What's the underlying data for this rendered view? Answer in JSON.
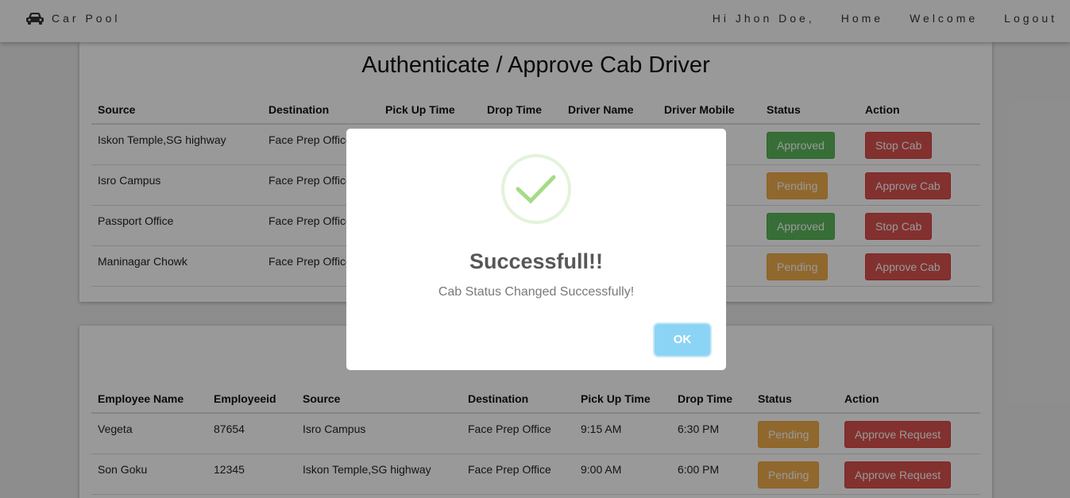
{
  "navbar": {
    "brand": "Car Pool",
    "greeting": "Hi Jhon Doe,",
    "links": [
      "Home",
      "Welcome",
      "Logout"
    ]
  },
  "cab_section": {
    "title": "Authenticate / Approve Cab Driver",
    "headers": [
      "Source",
      "Destination",
      "Pick Up Time",
      "Drop Time",
      "Driver Name",
      "Driver Mobile",
      "Status",
      "Action"
    ],
    "rows": [
      {
        "source": "Iskon Temple,SG highway",
        "destination": "Face Prep Office",
        "status": "Approved",
        "action": "Stop Cab"
      },
      {
        "source": "Isro Campus",
        "destination": "Face Prep Office",
        "status": "Pending",
        "action": "Approve Cab"
      },
      {
        "source": "Passport Office",
        "destination": "Face Prep Office",
        "status": "Approved",
        "action": "Stop Cab"
      },
      {
        "source": "Maninagar Chowk",
        "destination": "Face Prep Office",
        "status": "Pending",
        "action": "Approve Cab"
      }
    ]
  },
  "employee_section": {
    "headers": [
      "Employee Name",
      "Employeeid",
      "Source",
      "Destination",
      "Pick Up Time",
      "Drop Time",
      "Status",
      "Action"
    ],
    "rows": [
      {
        "name": "Vegeta",
        "id": "87654",
        "source": "Isro Campus",
        "destination": "Face Prep Office",
        "pickup": "9:15 AM",
        "drop": "6:30 PM",
        "status": "Pending",
        "action": "Approve Request"
      },
      {
        "name": "Son Goku",
        "id": "12345",
        "source": "Iskon Temple,SG highway",
        "destination": "Face Prep Office",
        "pickup": "9:00 AM",
        "drop": "6:00 PM",
        "status": "Pending",
        "action": "Approve Request"
      }
    ]
  },
  "modal": {
    "title": "Successfull!!",
    "message": "Cab Status Changed Successfully!",
    "ok_label": "OK"
  },
  "colors": {
    "approved": "#5cb85c",
    "pending": "#f0ad4e",
    "danger": "#d9534f",
    "ok_button": "#8cd4f5",
    "check": "#a5dc86"
  },
  "icons": {
    "brand": "car-icon",
    "modal": "success-check-icon"
  }
}
